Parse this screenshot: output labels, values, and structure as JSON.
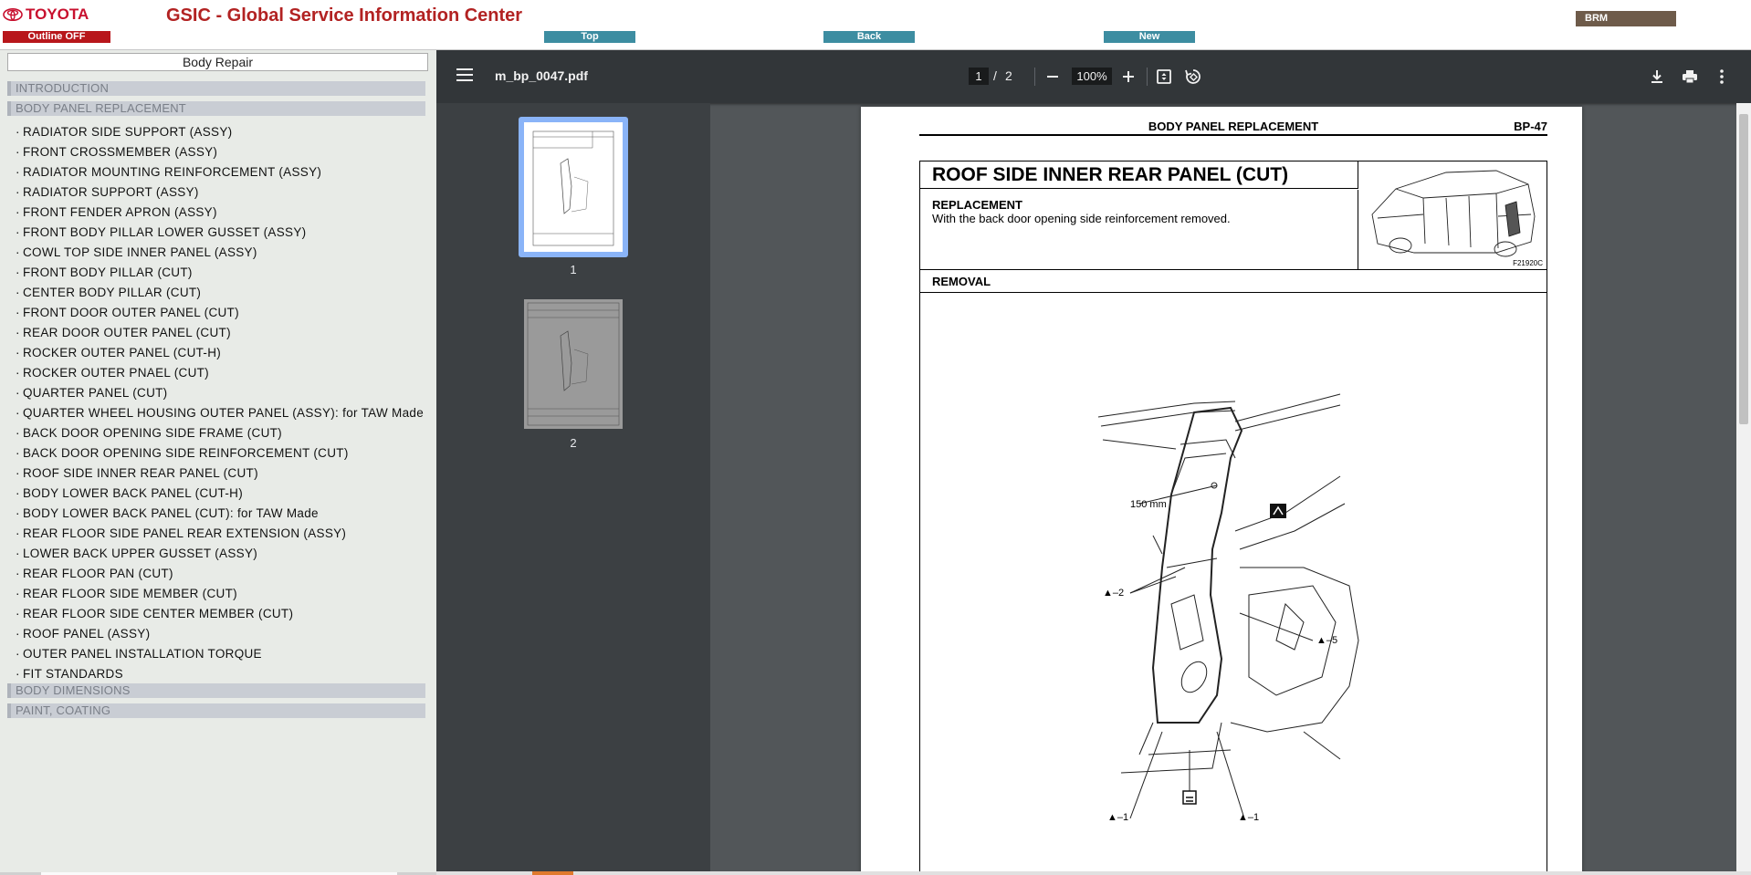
{
  "header": {
    "logo": "TOYOTA",
    "title": "GSIC - Global Service Information Center",
    "outline_btn": "Outline OFF",
    "nav": {
      "top": "Top",
      "back": "Back",
      "new": "New"
    },
    "brm": "BRM",
    "colors": {
      "brand_red": "#c8102e",
      "nav_teal": "#3d8da1",
      "brm_brown": "#6e5b4a"
    }
  },
  "left": {
    "section": "Body Repair",
    "categories": [
      "INTRODUCTION",
      "BODY PANEL REPLACEMENT",
      "BODY DIMENSIONS",
      "PAINT, COATING"
    ],
    "items": [
      "RADIATOR SIDE SUPPORT (ASSY)",
      "FRONT CROSSMEMBER (ASSY)",
      "RADIATOR MOUNTING REINFORCEMENT (ASSY)",
      "RADIATOR SUPPORT (ASSY)",
      "FRONT FENDER APRON (ASSY)",
      "FRONT BODY PILLAR LOWER GUSSET (ASSY)",
      "COWL TOP SIDE INNER PANEL (ASSY)",
      "FRONT BODY PILLAR (CUT)",
      "CENTER BODY PILLAR (CUT)",
      "FRONT DOOR OUTER PANEL (CUT)",
      "REAR DOOR OUTER PANEL (CUT)",
      "ROCKER OUTER PANEL (CUT-H)",
      "ROCKER OUTER PNAEL (CUT)",
      "QUARTER PANEL (CUT)",
      "QUARTER WHEEL HOUSING OUTER PANEL (ASSY): for TAW Made",
      "BACK DOOR OPENING SIDE FRAME (CUT)",
      "BACK DOOR OPENING SIDE REINFORCEMENT (CUT)",
      "ROOF SIDE INNER REAR PANEL (CUT)",
      "BODY LOWER BACK PANEL (CUT-H)",
      "BODY LOWER BACK PANEL (CUT): for TAW Made",
      "REAR FLOOR SIDE PANEL REAR EXTENSION (ASSY)",
      "LOWER BACK UPPER GUSSET (ASSY)",
      "REAR FLOOR PAN (CUT)",
      "REAR FLOOR SIDE MEMBER (CUT)",
      "REAR FLOOR SIDE CENTER MEMBER (CUT)",
      "ROOF PANEL (ASSY)",
      "OUTER PANEL INSTALLATION TORQUE",
      "FIT STANDARDS"
    ]
  },
  "viewer": {
    "file_name": "m_bp_0047.pdf",
    "page_current": "1",
    "page_sep": "/",
    "page_total": "2",
    "zoom": "100%",
    "thumb_labels": [
      "1",
      "2"
    ],
    "icons": [
      "menu-icon",
      "zoom-out-icon",
      "zoom-in-icon",
      "fit-page-icon",
      "rotate-icon",
      "download-icon",
      "print-icon",
      "more-options-icon"
    ]
  },
  "doc": {
    "header_title": "BODY PANEL REPLACEMENT",
    "page_code": "BP-47",
    "title": "ROOF SIDE INNER REAR PANEL (CUT)",
    "replacement_head": "REPLACEMENT",
    "replacement_text": "With the back door opening side reinforcement removed.",
    "fig_code": "F21920C",
    "removal_head": "REMOVAL",
    "diagram_labels": {
      "dim": "150 mm",
      "l2": "▲–2",
      "l5": "▲–5",
      "l1a": "▲–1",
      "l1b": "▲–1"
    }
  }
}
